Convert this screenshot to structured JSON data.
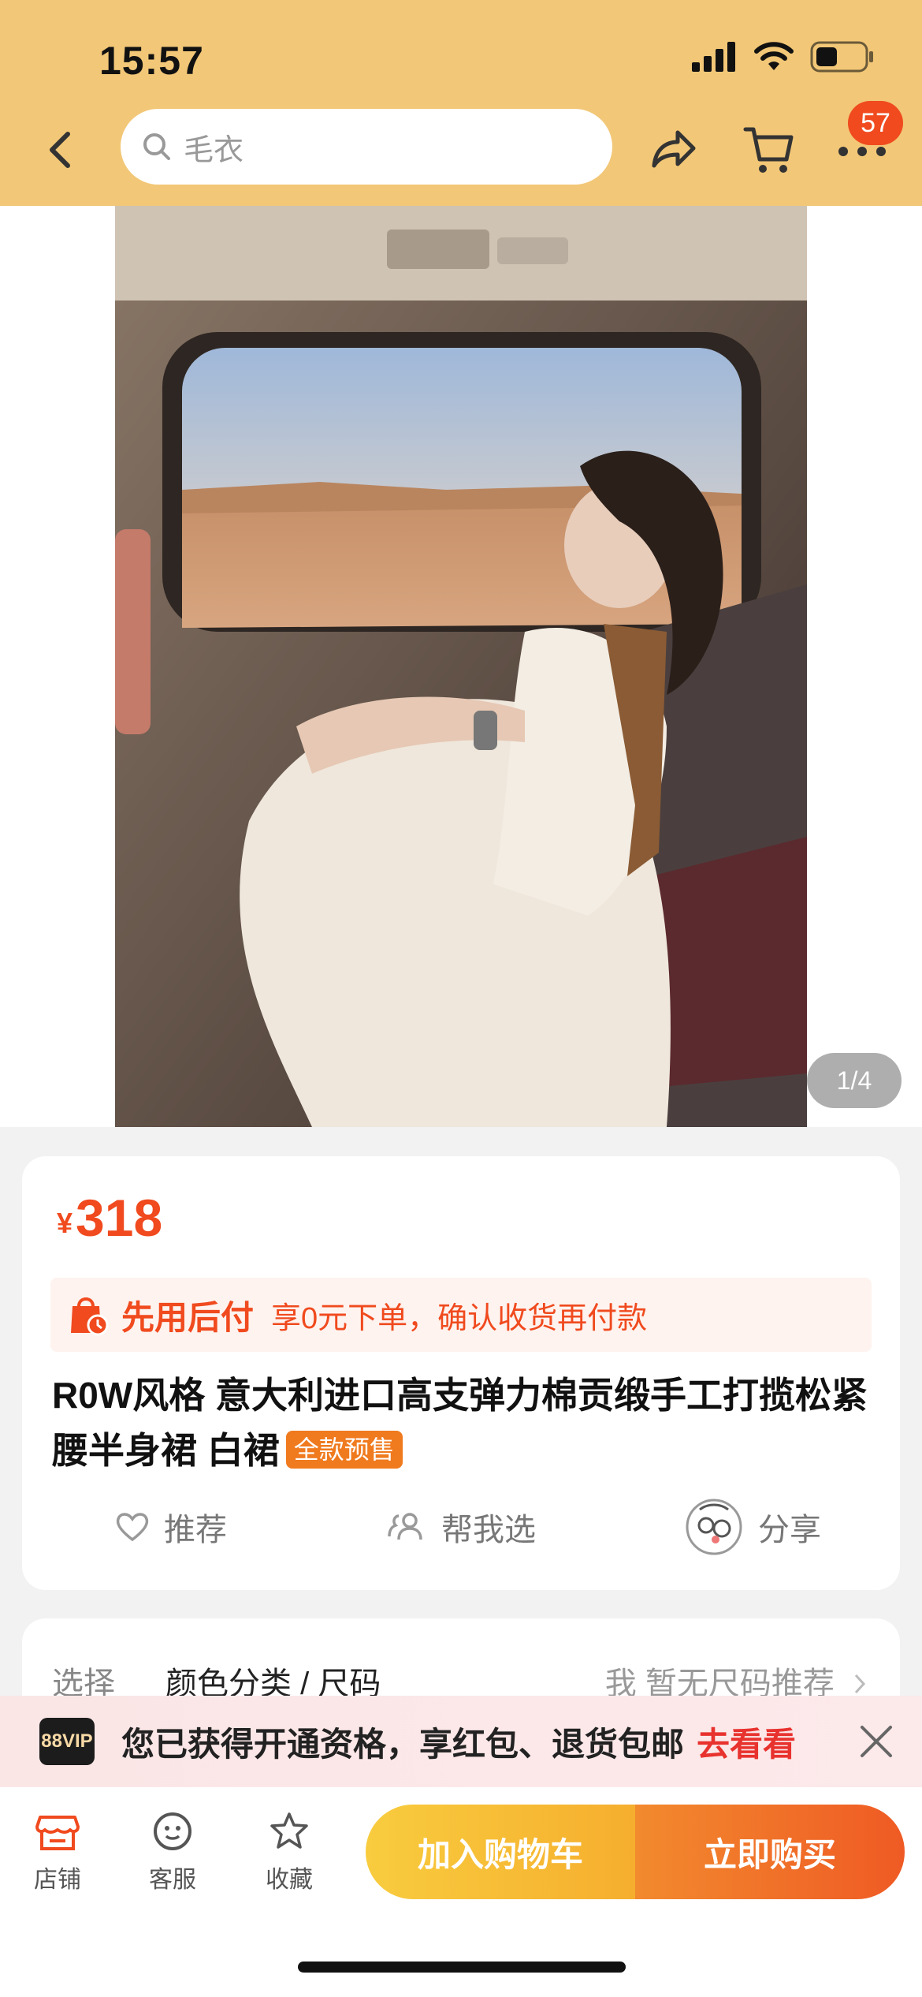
{
  "status_bar": {
    "time": "15:57"
  },
  "header": {
    "search_placeholder": "毛衣",
    "cart_badge": "57"
  },
  "gallery": {
    "page_indicator": "1/4"
  },
  "product": {
    "currency": "¥",
    "price": "318",
    "paylater_title": "先用后付",
    "paylater_desc": "享0元下单，确认收货再付款",
    "title": "R0W风格 意大利进口高支弹力棉贡缎手工打揽松紧腰半身裙 白裙",
    "presale_badge": "全款预售",
    "actions": {
      "recommend": "推荐",
      "help_choose": "帮我选",
      "share": "分享"
    }
  },
  "options": {
    "label": "选择",
    "value": "颜色分类 / 尺码",
    "right": "我 暂无尺码推荐"
  },
  "vip_banner": {
    "logo": "88VIP",
    "text": "您已获得开通资格，享红包、退货包邮",
    "link": "去看看"
  },
  "bottom_bar": {
    "shop": "店铺",
    "service": "客服",
    "favorite": "收藏",
    "add_to_cart": "加入购物车",
    "buy_now": "立即购买"
  },
  "colors": {
    "header_bg": "#f2c777",
    "accent": "#f04a1e",
    "cart_button": "#f8cc3e",
    "buy_button": "#ef5a24"
  }
}
